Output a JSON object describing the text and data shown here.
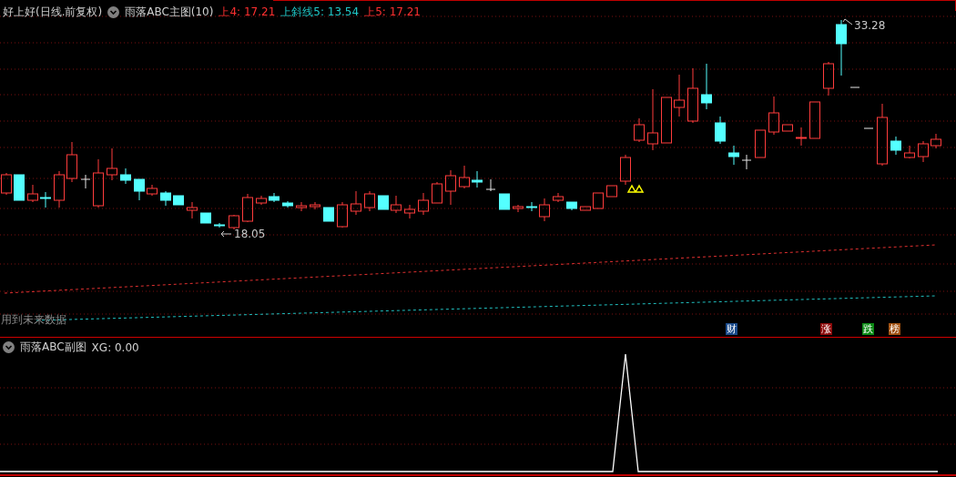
{
  "main_panel": {
    "stock": "好上好(日线.前复权)",
    "indicator": "雨落ABC主图(10)",
    "values": [
      {
        "label": "上4: 17.21",
        "color": "#ff3030"
      },
      {
        "label": "上斜线5: 13.54",
        "color": "#20c8c8"
      },
      {
        "label": "上5: 17.21",
        "color": "#ff3030"
      }
    ],
    "high_label": "33.28",
    "low_label": "18.05",
    "warning": "用到未来数据",
    "tags": [
      {
        "label": "财",
        "color": "#1a4a8a"
      },
      {
        "label": "涨",
        "color": "#8c0a0a"
      },
      {
        "label": "跌",
        "color": "#0a8a14"
      },
      {
        "label": "榜",
        "color": "#a05010"
      }
    ]
  },
  "sub_panel": {
    "indicator": "雨落ABC副图",
    "value": "XG: 0.00"
  }
}
